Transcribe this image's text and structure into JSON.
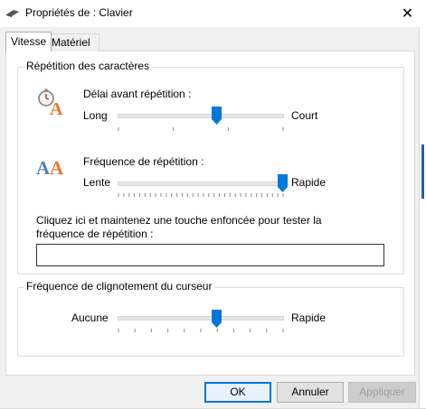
{
  "window": {
    "title": "Propriétés de : Clavier",
    "close_icon": "close-icon",
    "close_glyph": "✕"
  },
  "tabs": [
    {
      "label": "Vitesse",
      "selected": true
    },
    {
      "label": "Matériel",
      "selected": false
    }
  ],
  "repeat_group": {
    "title": "Répétition des caractères",
    "delay": {
      "label": "Délai avant répétition :",
      "min_label": "Long",
      "max_label": "Court",
      "icon": "stopwatch-letter-a-icon",
      "value_fraction": 0.6,
      "tick_count": 4
    },
    "rate": {
      "label": "Fréquence de répétition :",
      "min_label": "Lente",
      "max_label": "Rapide",
      "icon": "double-letter-a-icon",
      "value_fraction": 1.0,
      "tick_count": 32
    },
    "test": {
      "label": "Cliquez ici et maintenez une touche enfoncée pour tester la fréquence de répétition :",
      "value": ""
    }
  },
  "cursor_group": {
    "title": "Fréquence de clignotement du curseur",
    "min_label": "Aucune",
    "max_label": "Rapide",
    "value_fraction": 0.6,
    "tick_count": 11
  },
  "buttons": {
    "ok": "OK",
    "cancel": "Annuler",
    "apply": "Appliquer",
    "apply_enabled": false
  },
  "colors": {
    "accent": "#0078d7",
    "icon_orange": "#e8772e",
    "icon_blue": "#5b7fb4"
  }
}
